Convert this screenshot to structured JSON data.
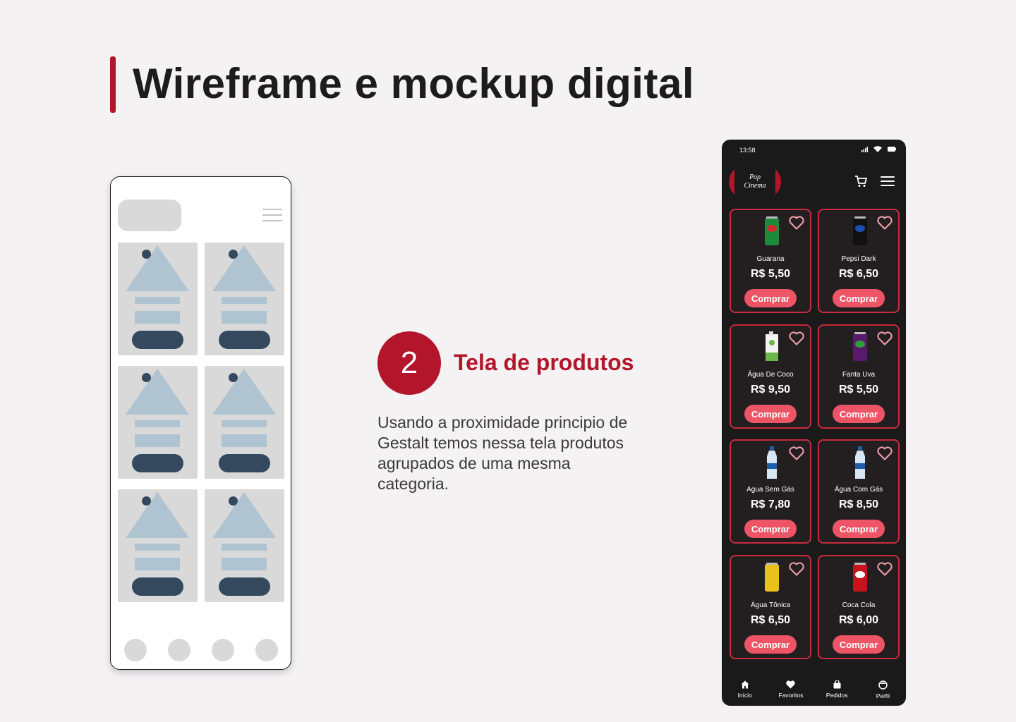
{
  "header": {
    "title": "Wireframe e mockup digital"
  },
  "section": {
    "step_number": "2",
    "step_title": "Tela de produtos",
    "description": "Usando a proximidade principio de Gestalt temos nessa tela produtos agrupados de uma mesma categoria."
  },
  "mockup": {
    "status_time": "13:58",
    "logo_line1": "Pop",
    "logo_line2": "Cinema",
    "products": [
      {
        "name": "Guarana",
        "price": "R$ 5,50",
        "button": "Comprar"
      },
      {
        "name": "Pepsi Dark",
        "price": "R$ 6,50",
        "button": "Comprar"
      },
      {
        "name": "Água De Coco",
        "price": "R$ 9,50",
        "button": "Comprar"
      },
      {
        "name": "Fanta Uva",
        "price": "R$ 5,50",
        "button": "Comprar"
      },
      {
        "name": "Agua Sem Gás",
        "price": "R$ 7,80",
        "button": "Comprar"
      },
      {
        "name": "Água Com Gás",
        "price": "R$ 8,50",
        "button": "Comprar"
      },
      {
        "name": "Água Tônica",
        "price": "R$ 6,50",
        "button": "Comprar"
      },
      {
        "name": "Coca Cola",
        "price": "R$ 6,00",
        "button": "Comprar"
      }
    ],
    "nav": [
      {
        "label": "Início",
        "icon": "home-icon"
      },
      {
        "label": "Favoritos",
        "icon": "heart-icon"
      },
      {
        "label": "Pedidos",
        "icon": "bag-icon"
      },
      {
        "label": "Perfil",
        "icon": "profile-icon"
      }
    ]
  },
  "colors": {
    "accent": "#b3152a",
    "button": "#ed5465",
    "mockup_bg": "#1b1a1a",
    "wireframe_dark": "#34495e",
    "wireframe_light": "#afc3d1"
  }
}
